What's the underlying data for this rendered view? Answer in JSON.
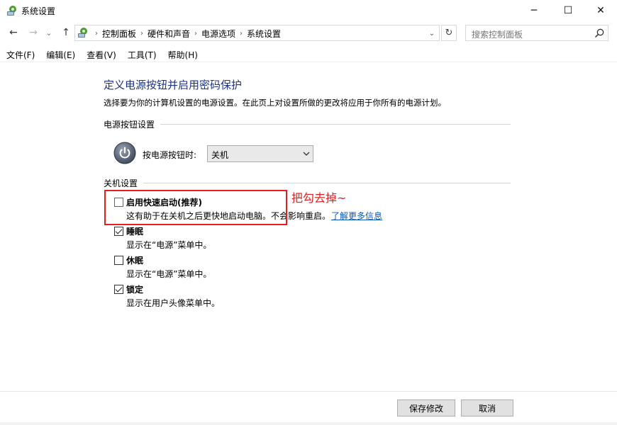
{
  "window": {
    "title": "系统设置",
    "minimize_glyph": "─",
    "maximize_glyph": "☐",
    "close_glyph": "✕"
  },
  "nav": {
    "back_glyph": "←",
    "forward_glyph": "→",
    "recent_glyph": "⌄",
    "up_glyph": "↑"
  },
  "address": {
    "breadcrumbs": [
      "控制面板",
      "硬件和声音",
      "电源选项",
      "系统设置"
    ],
    "separator": "›",
    "dropdown_glyph": "⌄",
    "refresh_glyph": "↻"
  },
  "search": {
    "placeholder": "搜索控制面板"
  },
  "menu": {
    "items": [
      "文件(F)",
      "编辑(E)",
      "查看(V)",
      "工具(T)",
      "帮助(H)"
    ]
  },
  "content": {
    "heading": "定义电源按钮并启用密码保护",
    "subtitle": "选择要为你的计算机设置的电源设置。在此页上对设置所做的更改将应用于你所有的电源计划。",
    "power_section": {
      "label": "电源按钮设置",
      "power_button_label": "按电源按钮时:",
      "power_button_value": "关机"
    },
    "shutdown_section": {
      "label": "关机设置",
      "options": [
        {
          "title": "启用快速启动(推荐)",
          "desc": "这有助于在关机之后更快地启动电脑。不会影响重启。",
          "link": "了解更多信息",
          "checked": false
        },
        {
          "title": "睡眠",
          "desc": "显示在“电源”菜单中。",
          "checked": true
        },
        {
          "title": "休眠",
          "desc": "显示在“电源”菜单中。",
          "checked": false
        },
        {
          "title": "锁定",
          "desc": "显示在用户头像菜单中。",
          "checked": true
        }
      ]
    },
    "annotation": "把勾去掉~"
  },
  "buttons": {
    "save": "保存修改",
    "cancel": "取消"
  },
  "colors": {
    "heading": "#1e3287",
    "link": "#0a58c2",
    "annotation": "#e02020"
  }
}
